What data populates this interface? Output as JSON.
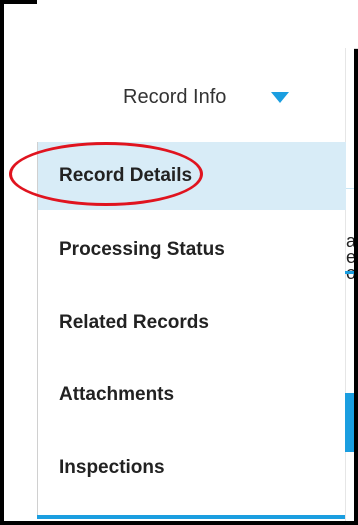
{
  "menu": {
    "title": "Record Info",
    "items": [
      {
        "label": "Record Details",
        "active": true
      },
      {
        "label": "Processing Status",
        "active": false
      },
      {
        "label": "Related Records",
        "active": false
      },
      {
        "label": "Attachments",
        "active": false
      },
      {
        "label": "Inspections",
        "active": false
      }
    ]
  },
  "right_fragment_text": "ac\ner\non",
  "colors": {
    "accent": "#1b9ee0",
    "active_bg": "#d8ecf7",
    "highlight": "#e0141f"
  }
}
